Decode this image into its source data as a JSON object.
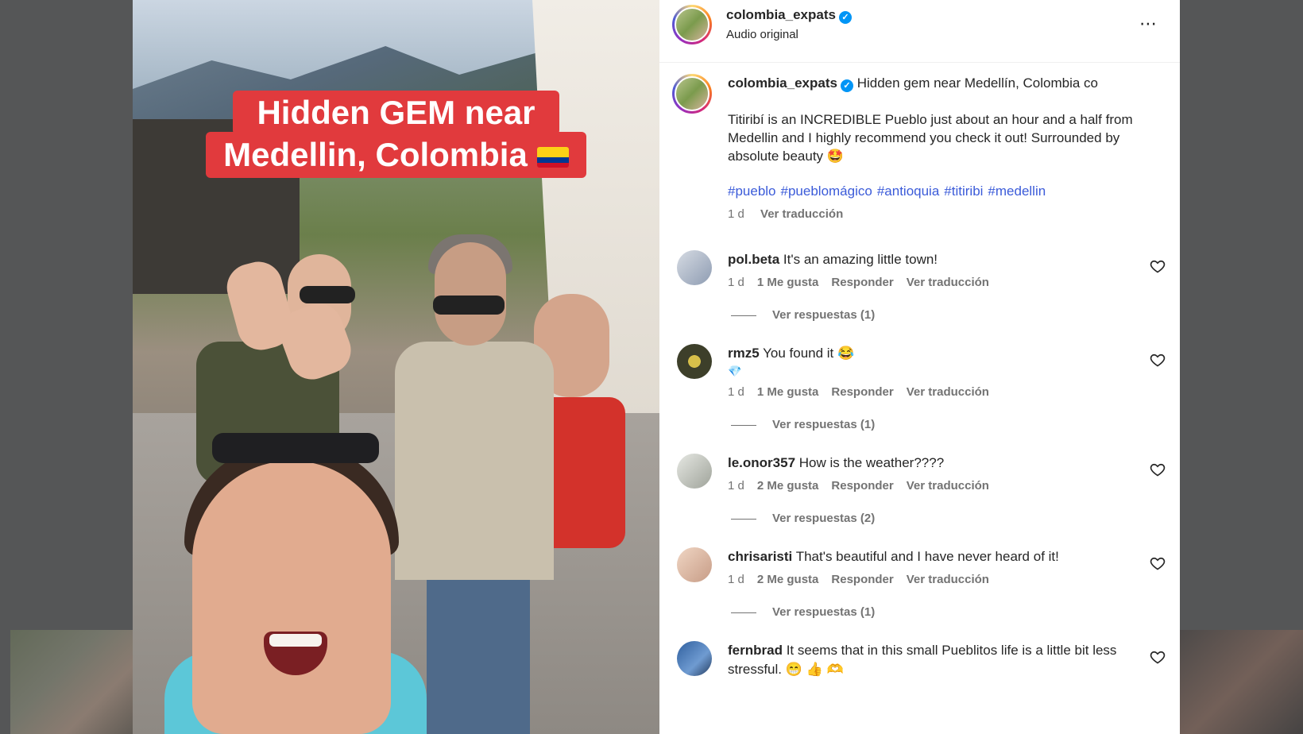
{
  "overlay": {
    "line1": "Hidden GEM near",
    "line2": "Medellin, Colombia",
    "flag_colors": [
      "#fcd116",
      "#003893",
      "#ce1126"
    ]
  },
  "header": {
    "username": "colombia_expats",
    "subtitle": "Audio original",
    "more_icon": "⋯"
  },
  "caption": {
    "username": "colombia_expats",
    "first_line": "Hidden gem near Medellín, Colombia co",
    "body": "Titiribí is an INCREDIBLE Pueblo just about an hour and a half from Medellin and I highly recommend you check it out! Surrounded by absolute beauty 🤩",
    "hashtags": [
      "#pueblo",
      "#pueblomágico",
      "#antioquia",
      "#titiribi",
      "#medellin"
    ],
    "time": "1 d",
    "translate": "Ver traducción"
  },
  "comments": [
    {
      "username": "pol.beta",
      "text": "It's an amazing little town!",
      "time": "1 d",
      "likes": "1 Me gusta",
      "reply": "Responder",
      "translate": "Ver traducción",
      "replies": "Ver respuestas (1)",
      "avatar_color": "#a9b4c4"
    },
    {
      "username": "rmz5",
      "text": "You found it 😂",
      "extra": "💎",
      "time": "1 d",
      "likes": "1 Me gusta",
      "reply": "Responder",
      "translate": "Ver traducción",
      "replies": "Ver respuestas (1)",
      "avatar_color": "#3d3f2a"
    },
    {
      "username": "le.onor357",
      "text": "How is the weather????",
      "time": "1 d",
      "likes": "2 Me gusta",
      "reply": "Responder",
      "translate": "Ver traducción",
      "replies": "Ver respuestas (2)",
      "avatar_color": "#c7c9c4"
    },
    {
      "username": "chrisaristi",
      "text": "That's beautiful and I have never heard of it!",
      "time": "1 d",
      "likes": "2 Me gusta",
      "reply": "Responder",
      "translate": "Ver traducción",
      "replies": "Ver respuestas (1)",
      "avatar_color": "#d9b6a0"
    },
    {
      "username": "fernbrad",
      "text": "It seems that in this small Pueblitos life is a little bit less stressful. 😁 👍 🫶",
      "avatar_color": "#2f5f9e"
    }
  ],
  "colors": {
    "link_blue": "#3b5bd9",
    "verified_blue": "#0095f6",
    "overlay_red": "#e13a3d",
    "muted": "#737373"
  }
}
